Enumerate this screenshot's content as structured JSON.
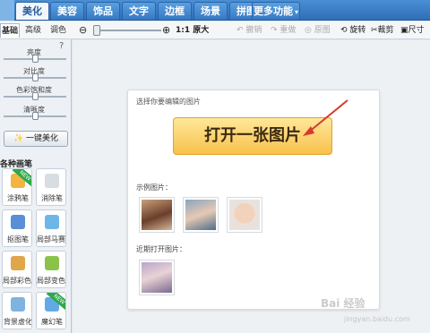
{
  "nav": {
    "tabs": [
      {
        "label": "美化",
        "active": true
      },
      {
        "label": "美容"
      },
      {
        "label": "饰品"
      },
      {
        "label": "文字"
      },
      {
        "label": "边框"
      },
      {
        "label": "场景"
      },
      {
        "label": "拼图"
      }
    ],
    "more": "更多功能"
  },
  "subtabs": [
    "基础",
    "高级",
    "调色"
  ],
  "toolbar": {
    "ratio": "1:1 原大",
    "undo": "撤销",
    "redo": "重做",
    "reset": "原图",
    "rotate": "旋转",
    "crop": "裁剪",
    "size": "尺寸"
  },
  "sliders": [
    {
      "label": "亮度",
      "value": 0.5
    },
    {
      "label": "对比度",
      "value": 0.5
    },
    {
      "label": "色彩饱和度",
      "value": 0.5
    },
    {
      "label": "清晰度",
      "value": 0.5
    }
  ],
  "onekey_label": "一键美化",
  "brushes": {
    "title": "各种画笔",
    "items": [
      {
        "label": "涂鸦笔",
        "color": "#f2b544",
        "badge": "NEW"
      },
      {
        "label": "消除笔",
        "color": "#d8dde2"
      },
      {
        "label": "抠图笔",
        "color": "#5a8fd8"
      },
      {
        "label": "局部马赛克",
        "color": "#6fb6e8"
      },
      {
        "label": "局部彩色笔",
        "color": "#e0a64a"
      },
      {
        "label": "局部变色笔",
        "color": "#8bc34a"
      },
      {
        "label": "背景虚化",
        "color": "#7fb3e0"
      },
      {
        "label": "魔幻笔",
        "color": "#62a9e6",
        "badge": "NEW"
      }
    ]
  },
  "card": {
    "hint": "选择你要编辑的图片",
    "open_button": "打开一张图片",
    "sample_label": "示例图片：",
    "recent_label": "近期打开图片："
  },
  "colors": {
    "accent": "#2f6fb8",
    "button": "#f8c14a",
    "arrow": "#d83a2e"
  },
  "watermark": {
    "main": "Bai 经验",
    "sub": "jingyan.baidu.com"
  }
}
